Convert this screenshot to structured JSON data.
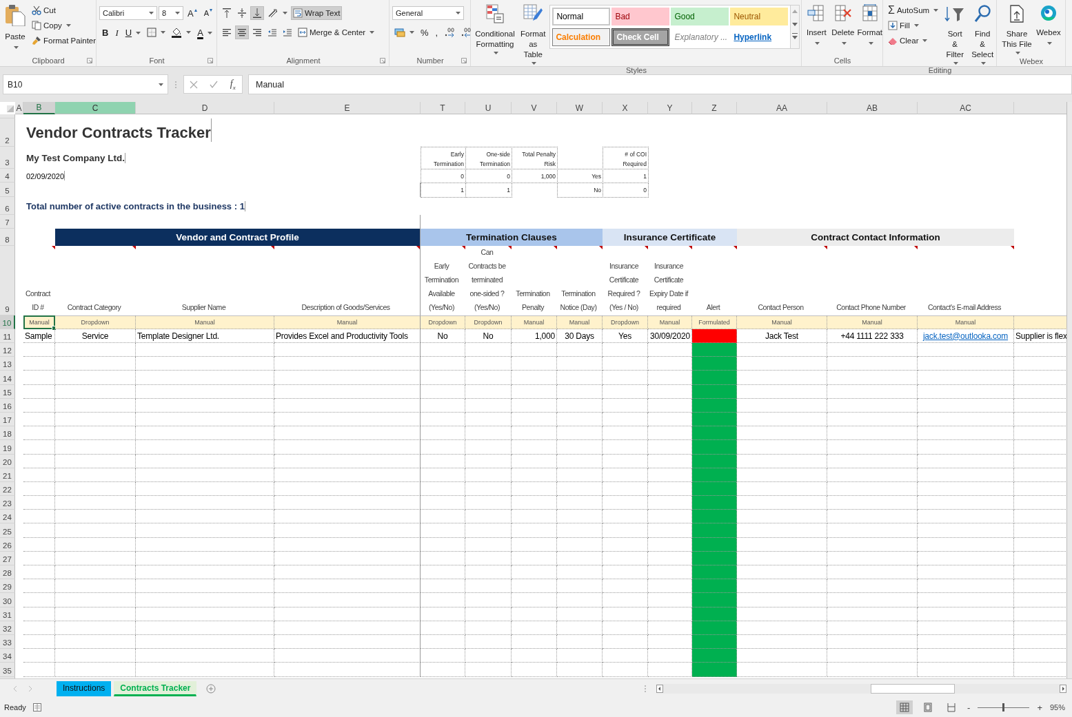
{
  "ribbon": {
    "clipboard": {
      "paste": "Paste",
      "cut": "Cut",
      "copy": "Copy",
      "format_painter": "Format Painter",
      "label": "Clipboard"
    },
    "font": {
      "name": "Calibri",
      "size": "8",
      "grow": "A",
      "shrink": "A",
      "bold": "B",
      "italic": "I",
      "underline": "U",
      "font_color": "A",
      "label": "Font"
    },
    "alignment": {
      "vertical": [
        {
          "selected": false
        },
        {
          "selected": false
        },
        {
          "selected": true
        }
      ],
      "horizontal": [
        {
          "selected": false
        },
        {
          "selected": true
        },
        {
          "selected": false
        }
      ],
      "wrap_text": {
        "label": "Wrap Text",
        "on": true
      },
      "merge_center": "Merge & Center",
      "label": "Alignment"
    },
    "number": {
      "format": "General",
      "percent": "%",
      "comma": ",",
      "label": "Number"
    },
    "styles": {
      "conditional_formatting": "Conditional Formatting",
      "format_as_table": "Format as Table",
      "label": "Styles",
      "gallery": [
        {
          "label": "Normal",
          "kind": "normal"
        },
        {
          "label": "Bad",
          "kind": "bad"
        },
        {
          "label": "Good",
          "kind": "good"
        },
        {
          "label": "Neutral",
          "kind": "neutral"
        },
        {
          "label": "Calculation",
          "kind": "calculation"
        },
        {
          "label": "Check Cell",
          "kind": "check"
        },
        {
          "label": "Explanatory ...",
          "kind": "explanatory"
        },
        {
          "label": "Hyperlink",
          "kind": "hyperlink"
        }
      ]
    },
    "cells": {
      "insert": "Insert",
      "delete": "Delete",
      "format": "Format",
      "label": "Cells"
    },
    "editing": {
      "autosum_symbol": "Σ",
      "autosum": "AutoSum",
      "fill": "Fill",
      "clear": "Clear",
      "sort_filter": "Sort & Filter",
      "find_select": "Find & Select",
      "label": "Editing"
    },
    "webex": {
      "share": "Share This File",
      "webex": "Webex",
      "label": "Webex"
    }
  },
  "formula_bar": {
    "name_box": "B10",
    "function_symbol": "f$_{x}$",
    "value": "Manual"
  },
  "column_headers": [
    {
      "label": "A",
      "selected": false,
      "highlighted": false
    },
    {
      "label": "B",
      "selected": true,
      "highlighted": false
    },
    {
      "label": "C",
      "selected": false,
      "highlighted": true
    },
    {
      "label": "D",
      "selected": false,
      "highlighted": false
    },
    {
      "label": "E",
      "selected": false,
      "highlighted": false
    },
    {
      "label": "T",
      "selected": false,
      "highlighted": false
    },
    {
      "label": "U",
      "selected": false,
      "highlighted": false
    },
    {
      "label": "V",
      "selected": false,
      "highlighted": false
    },
    {
      "label": "W",
      "selected": false,
      "highlighted": false
    },
    {
      "label": "X",
      "selected": false,
      "highlighted": false
    },
    {
      "label": "Y",
      "selected": false,
      "highlighted": false
    },
    {
      "label": "Z",
      "selected": false,
      "highlighted": false
    },
    {
      "label": "AA",
      "selected": false,
      "highlighted": false
    },
    {
      "label": "AB",
      "selected": false,
      "highlighted": false
    },
    {
      "label": "AC",
      "selected": false,
      "highlighted": false
    }
  ],
  "rows": [
    {
      "label": "2",
      "kind": "plain",
      "selected": false,
      "cells": {
        "B": {
          "kind": "title",
          "text": "Vendor Contracts Tracker"
        }
      }
    },
    {
      "label": "3",
      "kind": "plain",
      "selected": false,
      "cells": {
        "B": {
          "kind": "subtitle",
          "text": "My Test Company Ltd."
        },
        "T": {
          "kind": "stat-head",
          "text": "Early Termination"
        },
        "U": {
          "kind": "stat-head",
          "text": "One-side Termination"
        },
        "V": {
          "kind": "stat-head",
          "text": "Total Penalty Risk"
        },
        "X": {
          "kind": "stat-head",
          "text": "# of COI Required"
        }
      }
    },
    {
      "label": "4",
      "kind": "plain",
      "selected": false,
      "cells": {
        "B": {
          "kind": "date",
          "text": "02/09/2020"
        },
        "T": {
          "kind": "stat",
          "text": "0"
        },
        "U": {
          "kind": "stat",
          "text": "0"
        },
        "V": {
          "kind": "stat",
          "text": "1,000"
        },
        "W": {
          "kind": "stat",
          "text": "Yes"
        },
        "X": {
          "kind": "stat",
          "text": "1"
        }
      }
    },
    {
      "label": "5",
      "kind": "plain",
      "selected": false,
      "cells": {
        "T": {
          "kind": "stat",
          "text": "1"
        },
        "U": {
          "kind": "stat",
          "text": "1"
        },
        "W": {
          "kind": "stat",
          "text": "No"
        },
        "X": {
          "kind": "stat",
          "text": "0"
        }
      }
    },
    {
      "label": "6",
      "kind": "plain",
      "selected": false,
      "cells": {
        "B": {
          "kind": "summary",
          "text": "Total number of active contracts in the business : 1"
        }
      }
    },
    {
      "label": "7",
      "kind": "plain",
      "selected": false
    },
    {
      "label": "8",
      "kind": "plain",
      "selected": false,
      "cells": {
        "C:E": {
          "kind": "band",
          "color": "#0c2f5e",
          "text": "Vendor and Contract Profile"
        },
        "T:W": {
          "kind": "band",
          "color": "#a9c5eb",
          "text": "Termination Clauses"
        },
        "X:Z": {
          "kind": "band",
          "color": "#d9e4f4",
          "text": "Insurance Certificate"
        },
        "AA:AC": {
          "kind": "band",
          "color": "#ececec",
          "text": "Contract Contact Information"
        }
      }
    },
    {
      "label": "9",
      "kind": "header",
      "selected": false,
      "cells": {
        "B": {
          "kind": "heading",
          "comment": true,
          "text": "Contract ID #"
        },
        "C": {
          "kind": "heading",
          "comment": true,
          "text": "Contract Category"
        },
        "D": {
          "kind": "heading",
          "comment": true,
          "text": "Supplier Name"
        },
        "E": {
          "kind": "heading",
          "comment": true,
          "text": "Description of Goods/Services"
        },
        "T": {
          "kind": "heading",
          "comment": true,
          "text": "Early Termination Available (Yes/No)"
        },
        "U": {
          "kind": "heading",
          "comment": true,
          "text": "Can Contracts be terminated one-sided ? (Yes/No)"
        },
        "V": {
          "kind": "heading",
          "comment": true,
          "text": "Termination Penalty"
        },
        "W": {
          "kind": "heading",
          "comment": true,
          "text": "Termination Notice (Day)"
        },
        "X": {
          "kind": "heading",
          "comment": true,
          "text": "Insurance Certificate Required ? (Yes / No)"
        },
        "Y": {
          "kind": "heading",
          "comment": true,
          "text": "Insurance Certificate Expiry Date if required"
        },
        "Z": {
          "kind": "heading",
          "comment": true,
          "text": "Alert"
        },
        "AA": {
          "kind": "heading",
          "comment": true,
          "text": "Contact Person"
        },
        "AB": {
          "kind": "heading",
          "comment": true,
          "text": "Contact Phone Number"
        },
        "AC": {
          "kind": "heading",
          "comment": true,
          "text": "Contact's E-mail Address"
        }
      }
    },
    {
      "label": "10",
      "kind": "guide",
      "selected": true,
      "cells": {
        "B": {
          "kind": "hint",
          "selected": true,
          "text": "Manual"
        },
        "C": {
          "kind": "hint",
          "selected": false,
          "text": "Dropdown"
        },
        "D": {
          "kind": "hint",
          "selected": false,
          "text": "Manual"
        },
        "E": {
          "kind": "hint",
          "selected": false,
          "text": "Manual"
        },
        "T": {
          "kind": "hint",
          "selected": false,
          "text": "Dropdown"
        },
        "U": {
          "kind": "hint",
          "selected": false,
          "text": "Dropdown"
        },
        "V": {
          "kind": "hint",
          "selected": false,
          "text": "Manual"
        },
        "W": {
          "kind": "hint",
          "selected": false,
          "text": "Manual"
        },
        "X": {
          "kind": "hint",
          "selected": false,
          "text": "Dropdown"
        },
        "Y": {
          "kind": "hint",
          "selected": false,
          "text": "Manual"
        },
        "Z": {
          "kind": "hint",
          "selected": false,
          "text": "Formulated"
        },
        "AA": {
          "kind": "hint",
          "selected": false,
          "text": "Manual"
        },
        "AB": {
          "kind": "hint",
          "selected": false,
          "text": "Manual"
        },
        "AC": {
          "kind": "hint",
          "selected": false,
          "text": "Manual"
        }
      }
    },
    {
      "label": "11",
      "kind": "record",
      "selected": false,
      "cells": {
        "B": {
          "kind": "text",
          "text": "Sample"
        },
        "C": {
          "kind": "centered",
          "text": "Service"
        },
        "D": {
          "kind": "text",
          "text": "Template Designer Ltd."
        },
        "E": {
          "kind": "text",
          "text": "Provides Excel and Productivity Tools"
        },
        "T": {
          "kind": "centered",
          "text": "No"
        },
        "U": {
          "kind": "centered",
          "text": "No"
        },
        "V": {
          "kind": "number",
          "text": "1,000"
        },
        "W": {
          "kind": "centered",
          "text": "30 Days"
        },
        "X": {
          "kind": "centered",
          "text": "Yes"
        },
        "Y": {
          "kind": "number",
          "text": "30/09/2020"
        },
        "Z": {
          "kind": "alert",
          "color": "#ff0000"
        },
        "AA": {
          "kind": "centered",
          "text": "Jack Test"
        },
        "AB": {
          "kind": "centered",
          "text": "+44 1111 222 333"
        },
        "AC": {
          "kind": "link",
          "text": "jack.test@outlooka.com"
        },
        "AD": {
          "kind": "text",
          "text": "Supplier is flex"
        }
      }
    },
    {
      "label": "12",
      "kind": "record",
      "selected": false,
      "cells": {
        "Z": {
          "kind": "alert",
          "color": "#00b050"
        }
      }
    },
    {
      "label": "13",
      "kind": "record",
      "selected": false,
      "cells": {
        "Z": {
          "kind": "alert",
          "color": "#00b050"
        }
      }
    },
    {
      "label": "14",
      "kind": "record",
      "selected": false,
      "cells": {
        "Z": {
          "kind": "alert",
          "color": "#00b050"
        }
      }
    },
    {
      "label": "15",
      "kind": "record",
      "selected": false,
      "cells": {
        "Z": {
          "kind": "alert",
          "color": "#00b050"
        }
      }
    },
    {
      "label": "16",
      "kind": "record",
      "selected": false,
      "cells": {
        "Z": {
          "kind": "alert",
          "color": "#00b050"
        }
      }
    },
    {
      "label": "17",
      "kind": "record",
      "selected": false,
      "cells": {
        "Z": {
          "kind": "alert",
          "color": "#00b050"
        }
      }
    },
    {
      "label": "18",
      "kind": "record",
      "selected": false,
      "cells": {
        "Z": {
          "kind": "alert",
          "color": "#00b050"
        }
      }
    },
    {
      "label": "19",
      "kind": "record",
      "selected": false,
      "cells": {
        "Z": {
          "kind": "alert",
          "color": "#00b050"
        }
      }
    },
    {
      "label": "20",
      "kind": "record",
      "selected": false,
      "cells": {
        "Z": {
          "kind": "alert",
          "color": "#00b050"
        }
      }
    },
    {
      "label": "21",
      "kind": "record",
      "selected": false,
      "cells": {
        "Z": {
          "kind": "alert",
          "color": "#00b050"
        }
      }
    },
    {
      "label": "22",
      "kind": "record",
      "selected": false,
      "cells": {
        "Z": {
          "kind": "alert",
          "color": "#00b050"
        }
      }
    },
    {
      "label": "23",
      "kind": "record",
      "selected": false,
      "cells": {
        "Z": {
          "kind": "alert",
          "color": "#00b050"
        }
      }
    },
    {
      "label": "24",
      "kind": "record",
      "selected": false,
      "cells": {
        "Z": {
          "kind": "alert",
          "color": "#00b050"
        }
      }
    },
    {
      "label": "25",
      "kind": "record",
      "selected": false,
      "cells": {
        "Z": {
          "kind": "alert",
          "color": "#00b050"
        }
      }
    },
    {
      "label": "26",
      "kind": "record",
      "selected": false,
      "cells": {
        "Z": {
          "kind": "alert",
          "color": "#00b050"
        }
      }
    },
    {
      "label": "27",
      "kind": "record",
      "selected": false,
      "cells": {
        "Z": {
          "kind": "alert",
          "color": "#00b050"
        }
      }
    },
    {
      "label": "28",
      "kind": "record",
      "selected": false,
      "cells": {
        "Z": {
          "kind": "alert",
          "color": "#00b050"
        }
      }
    },
    {
      "label": "29",
      "kind": "record",
      "selected": false,
      "cells": {
        "Z": {
          "kind": "alert",
          "color": "#00b050"
        }
      }
    },
    {
      "label": "30",
      "kind": "record",
      "selected": false,
      "cells": {
        "Z": {
          "kind": "alert",
          "color": "#00b050"
        }
      }
    },
    {
      "label": "31",
      "kind": "record",
      "selected": false,
      "cells": {
        "Z": {
          "kind": "alert",
          "color": "#00b050"
        }
      }
    },
    {
      "label": "32",
      "kind": "record",
      "selected": false,
      "cells": {
        "Z": {
          "kind": "alert",
          "color": "#00b050"
        }
      }
    },
    {
      "label": "33",
      "kind": "record",
      "selected": false,
      "cells": {
        "Z": {
          "kind": "alert",
          "color": "#00b050"
        }
      }
    },
    {
      "label": "34",
      "kind": "record",
      "selected": false,
      "cells": {
        "Z": {
          "kind": "alert",
          "color": "#00b050"
        }
      }
    },
    {
      "label": "35",
      "kind": "record",
      "selected": false,
      "cells": {
        "Z": {
          "kind": "alert",
          "color": "#00b050"
        }
      }
    }
  ],
  "sheet_tabs": [
    {
      "label": "Instructions",
      "selected": false,
      "color": "#00b0f0"
    },
    {
      "label": "Contracts Tracker",
      "selected": true,
      "color": "#00b050"
    }
  ],
  "status_bar": {
    "status": "Ready",
    "views": [
      {
        "selected": true
      },
      {
        "selected": false
      },
      {
        "selected": false
      }
    ],
    "zoom_out": "-",
    "zoom_in": "+",
    "zoom": {
      "level": 0.49,
      "reading": "95%"
    }
  }
}
